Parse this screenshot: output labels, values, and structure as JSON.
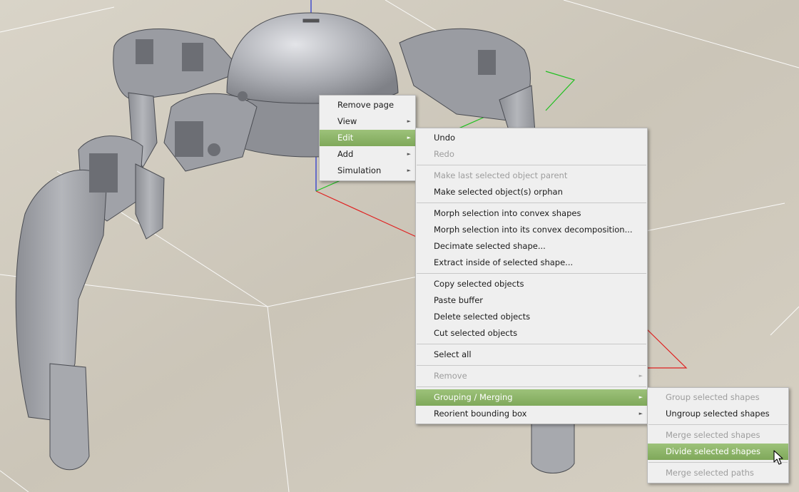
{
  "context_menu": {
    "items": [
      {
        "label": "Remove page",
        "submenu": false,
        "state": "normal"
      },
      {
        "label": "View",
        "submenu": true,
        "state": "normal"
      },
      {
        "label": "Edit",
        "submenu": true,
        "state": "selected"
      },
      {
        "label": "Add",
        "submenu": true,
        "state": "normal"
      },
      {
        "label": "Simulation",
        "submenu": true,
        "state": "normal"
      }
    ]
  },
  "edit_menu": {
    "undo": "Undo",
    "redo": "Redo",
    "make_parent": "Make last selected object parent",
    "make_orphan": "Make selected object(s) orphan",
    "morph_convex": "Morph selection into convex shapes",
    "morph_decomposition": "Morph selection into its convex decomposition...",
    "decimate": "Decimate selected shape...",
    "extract_inside": "Extract inside of selected shape...",
    "copy": "Copy selected objects",
    "paste": "Paste buffer",
    "delete": "Delete selected objects",
    "cut": "Cut selected objects",
    "select_all": "Select all",
    "remove": "Remove",
    "grouping_merging": "Grouping / Merging",
    "reorient_bbox": "Reorient bounding box"
  },
  "grouping_menu": {
    "group_shapes": "Group selected shapes",
    "ungroup_shapes": "Ungroup selected shapes",
    "merge_shapes": "Merge selected shapes",
    "divide_shapes": "Divide selected shapes",
    "merge_paths": "Merge selected paths"
  },
  "colors": {
    "menu_bg": "#efefef",
    "highlight": "#8db569",
    "disabled_text": "#9d9d9d",
    "floor": "#c9c3b5",
    "robot": "#a3a5ab"
  },
  "icons": {
    "submenu_arrow": "►",
    "cursor": "mouse-pointer-icon"
  }
}
